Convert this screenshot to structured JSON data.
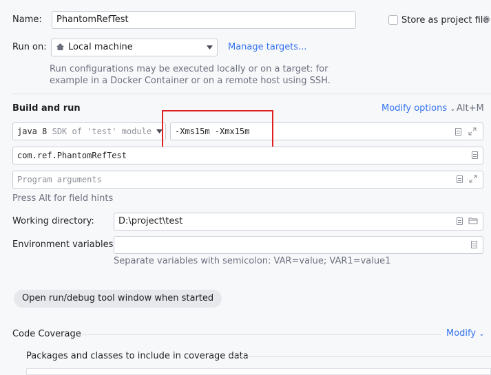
{
  "name": {
    "label": "Name:",
    "value": "PhantomRefTest"
  },
  "store_project_file": {
    "label": "Store as project file",
    "checked": false
  },
  "run_on": {
    "label": "Run on:",
    "value": "Local machine",
    "manage_targets": "Manage targets..."
  },
  "run_on_hint": {
    "line1": "Run configurations may be executed locally or on a target: for",
    "line2": "example in a Docker Container or on a remote host using SSH."
  },
  "build_and_run": {
    "title": "Build and run",
    "modify_options": "Modify options",
    "shortcut": "Alt+M",
    "jdk_version": "java 8",
    "jdk_detail": "SDK of 'test' module",
    "vm_options": "-Xms15m -Xmx15m",
    "main_class": "com.ref.PhantomRefTest",
    "program_args_placeholder": "Program arguments",
    "field_hint": "Press Alt for field hints"
  },
  "working_dir": {
    "label": "Working directory:",
    "value": "D:\\project\\test"
  },
  "env_vars": {
    "label": "Environment variables:",
    "value": "",
    "hint": "Separate variables with semicolon: VAR=value; VAR1=value1"
  },
  "open_tool_window": "Open run/debug tool window when started",
  "code_coverage": {
    "title": "Code Coverage",
    "modify": "Modify",
    "packages_label": "Packages and classes to include in coverage data"
  },
  "icons": [
    "home-icon",
    "dropdown-arrow-icon",
    "gear-icon",
    "chevron-down-icon",
    "document-icon",
    "expand-icon",
    "folder-icon"
  ]
}
